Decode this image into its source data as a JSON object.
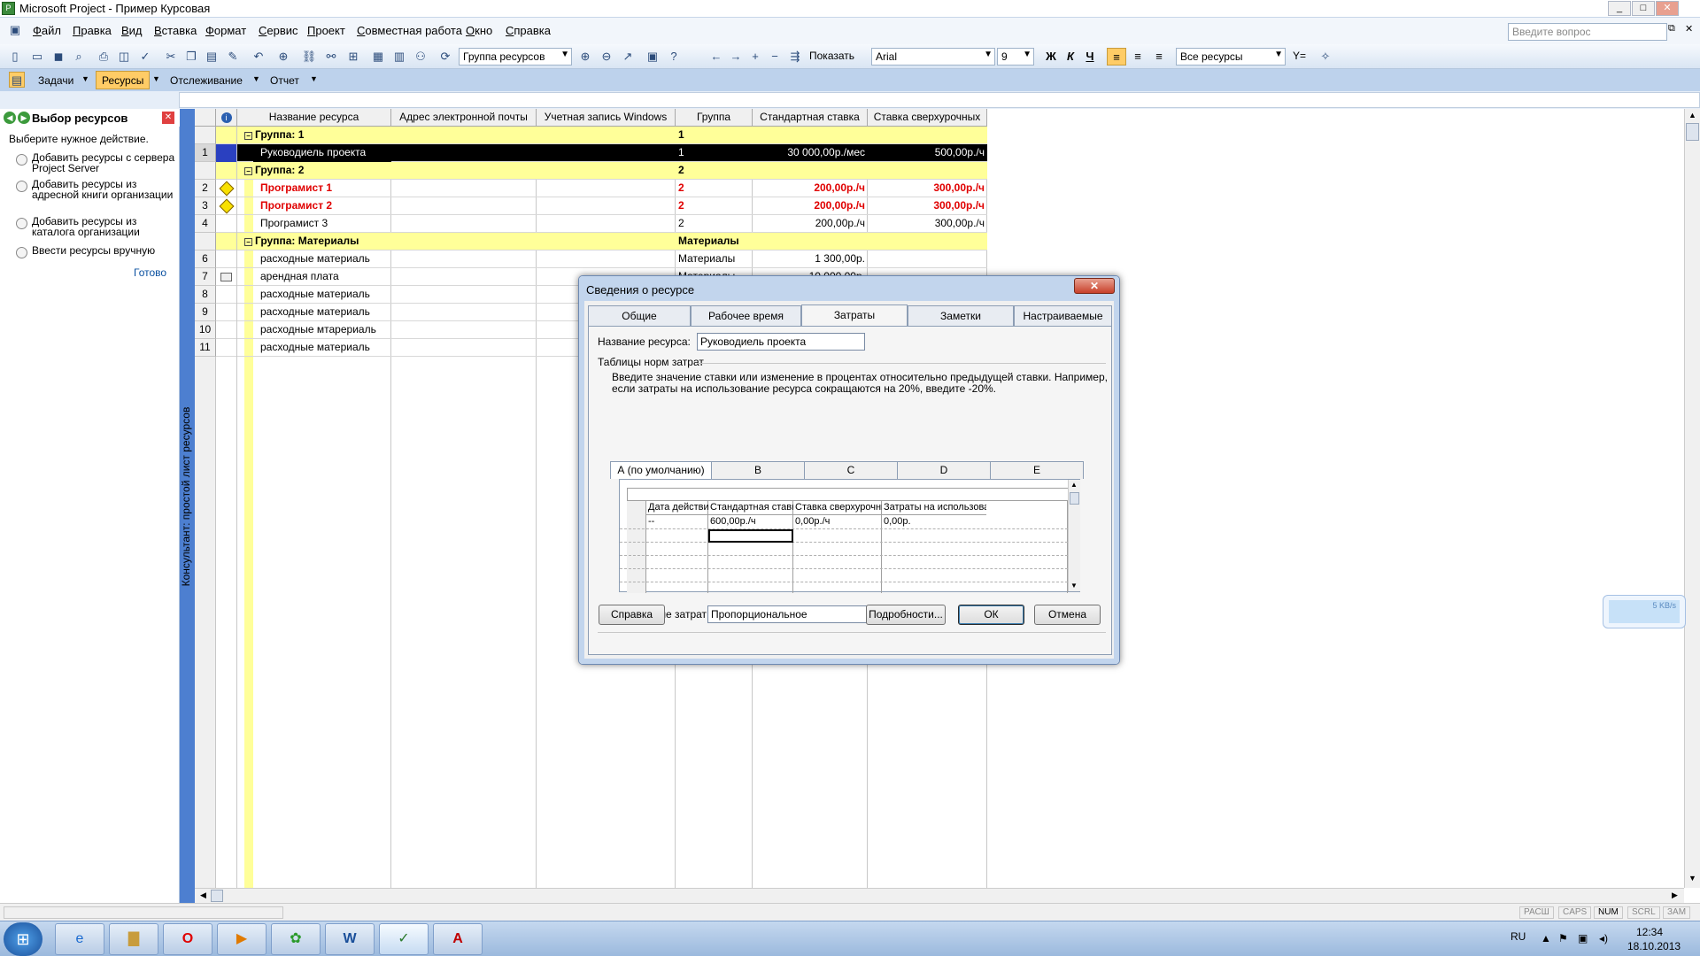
{
  "window": {
    "title": "Microsoft Project - Пример Курсовая",
    "min": "_",
    "max": "□",
    "close": "✕"
  },
  "menu": {
    "items": [
      "Файл",
      "Правка",
      "Вид",
      "Вставка",
      "Формат",
      "Сервис",
      "Проект",
      "Совместная работа",
      "Окно",
      "Справка"
    ],
    "ask_placeholder": "Введите вопрос",
    "doc_min": "_",
    "doc_max": "⧉",
    "doc_close": "✕"
  },
  "toolbar": {
    "group_combo": "Группа ресурсов",
    "show_label": "Показать",
    "font": "Arial",
    "size": "9",
    "bold": "Ж",
    "italic": "К",
    "underline": "Ч",
    "filter_combo": "Все ресурсы",
    "filter_icon": "Y="
  },
  "views": {
    "tasks": "Задачи",
    "resources": "Ресурсы",
    "tracking": "Отслеживание",
    "report": "Отчет"
  },
  "side_panel": {
    "title": "Выбор ресурсов",
    "hint": "Выберите нужное действие.",
    "options": [
      "Добавить ресурсы с сервера Project Server",
      "Добавить ресурсы из адресной книги организации",
      "Добавить ресурсы из каталога организации",
      "Ввести ресурсы вручную"
    ],
    "done": "Готово"
  },
  "vertical_bar": "Консультант: простой лист ресурсов",
  "grid": {
    "headers": [
      "Название ресурса",
      "Адрес электронной почты",
      "Учетная запись Windows",
      "Группа",
      "Стандартная ставка",
      "Ставка сверхурочных"
    ],
    "rows": [
      {
        "id": "",
        "kind": "group",
        "name": "Группа: 1",
        "group": "1",
        "rate": "",
        "ot": "",
        "icon": ""
      },
      {
        "id": "1",
        "kind": "sel",
        "name": "Руководиель проекта",
        "group": "1",
        "rate": "30 000,00р./мес",
        "ot": "500,00р./ч",
        "icon": ""
      },
      {
        "id": "",
        "kind": "group",
        "name": "Группа: 2",
        "group": "2",
        "rate": "",
        "ot": "",
        "icon": ""
      },
      {
        "id": "2",
        "kind": "red",
        "name": "Програмист 1",
        "group": "2",
        "rate": "200,00р./ч",
        "ot": "300,00р./ч",
        "icon": "warn"
      },
      {
        "id": "3",
        "kind": "red",
        "name": "Програмист 2",
        "group": "2",
        "rate": "200,00р./ч",
        "ot": "300,00р./ч",
        "icon": "warn"
      },
      {
        "id": "4",
        "kind": "normal",
        "name": "Програмист 3",
        "group": "2",
        "rate": "200,00р./ч",
        "ot": "300,00р./ч",
        "icon": ""
      },
      {
        "id": "",
        "kind": "group",
        "name": "Группа: Материалы",
        "group": "Материалы",
        "rate": "",
        "ot": "",
        "icon": ""
      },
      {
        "id": "6",
        "kind": "normal",
        "name": "расходные материаль",
        "group": "Материалы",
        "rate": "1 300,00р.",
        "ot": "",
        "icon": ""
      },
      {
        "id": "7",
        "kind": "normal",
        "name": "арендная плата",
        "group": "Материалы",
        "rate": "10 000,00р.",
        "ot": "",
        "icon": "note"
      },
      {
        "id": "8",
        "kind": "normal",
        "name": "расходные материаль",
        "group": "",
        "rate": "",
        "ot": "",
        "icon": ""
      },
      {
        "id": "9",
        "kind": "normal",
        "name": "расходные материаль",
        "group": "",
        "rate": "",
        "ot": "",
        "icon": ""
      },
      {
        "id": "10",
        "kind": "normal",
        "name": "расходные мтарериаль",
        "group": "",
        "rate": "",
        "ot": "",
        "icon": ""
      },
      {
        "id": "11",
        "kind": "normal",
        "name": "расходные материаль",
        "group": "",
        "rate": "",
        "ot": "",
        "icon": ""
      }
    ]
  },
  "dialog": {
    "title": "Сведения о ресурсе",
    "tabs": [
      "Общие",
      "Рабочее время",
      "Затраты",
      "Заметки",
      "Настраиваемые поля"
    ],
    "name_label": "Название ресурса:",
    "name_value": "Руководиель проекта",
    "section": "Таблицы норм затрат",
    "info": "Введите значение ставки или изменение в процентах относительно предыдущей ставки. Например, если затраты на использование ресурса сокращаются на 20%, введите -20%.",
    "rate_tabs": [
      "А (по умолчанию)",
      "В",
      "С",
      "D",
      "E"
    ],
    "table_headers": [
      "Дата действия",
      "Стандартная ставка",
      "Ставка сверхурочных",
      "Затраты на использование"
    ],
    "table_row": [
      "--",
      "600,00р./ч",
      "0,00р./ч",
      "0,00р."
    ],
    "accrual_label": "Начисление затрат:",
    "accrual_value": "Пропорциональное",
    "help": "Справка",
    "details": "Подробности...",
    "ok": "ОК",
    "cancel": "Отмена"
  },
  "network_widget": {
    "speed": "5 KB/s"
  },
  "statusbar": {
    "ext": "РАСШ",
    "caps": "CAPS",
    "num": "NUM",
    "scrl": "SCRL",
    "ovr": "ЗАМ"
  },
  "taskbar": {
    "lang": "RU",
    "time": "12:34",
    "date": "18.10.2013"
  }
}
